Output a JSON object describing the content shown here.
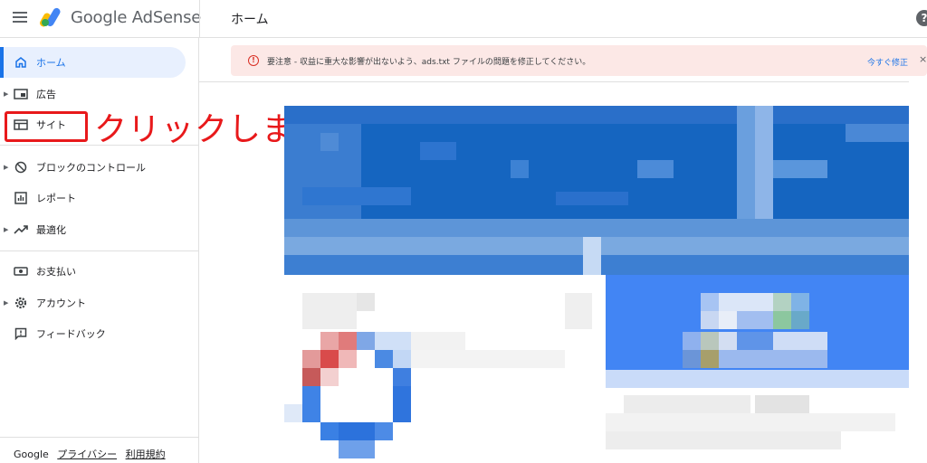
{
  "header": {
    "brand": "Google AdSense",
    "page_title": "ホーム",
    "help_icon": "?"
  },
  "sidebar": {
    "items": [
      {
        "label": "ホーム",
        "icon": "home-icon",
        "active": true
      },
      {
        "label": "広告",
        "icon": "ads-icon",
        "expandable": true
      },
      {
        "label": "サイト",
        "icon": "sites-icon"
      },
      {
        "label": "ブロックのコントロール",
        "icon": "block-icon",
        "expandable": true
      },
      {
        "label": "レポート",
        "icon": "reports-icon"
      },
      {
        "label": "最適化",
        "icon": "optimization-icon",
        "expandable": true
      },
      {
        "label": "お支払い",
        "icon": "payments-icon"
      },
      {
        "label": "アカウント",
        "icon": "account-gear-icon",
        "expandable": true
      },
      {
        "label": "フィードバック",
        "icon": "feedback-icon"
      }
    ]
  },
  "annotation": {
    "text": "クリックします",
    "color": "#e8191b"
  },
  "alert": {
    "message": "要注意 - 収益に重大な影響が出ないよう、ads.txt ファイルの問題を修正してください。",
    "action": "今すぐ修正",
    "close": "×"
  },
  "footer": {
    "google": "Google",
    "privacy": "プライバシー",
    "terms": "利用規約"
  },
  "colors": {
    "accent": "#1a73e8",
    "active_bg": "#e8f0fe",
    "alert_bg": "#fce8e6",
    "annotation": "#e8191b"
  }
}
